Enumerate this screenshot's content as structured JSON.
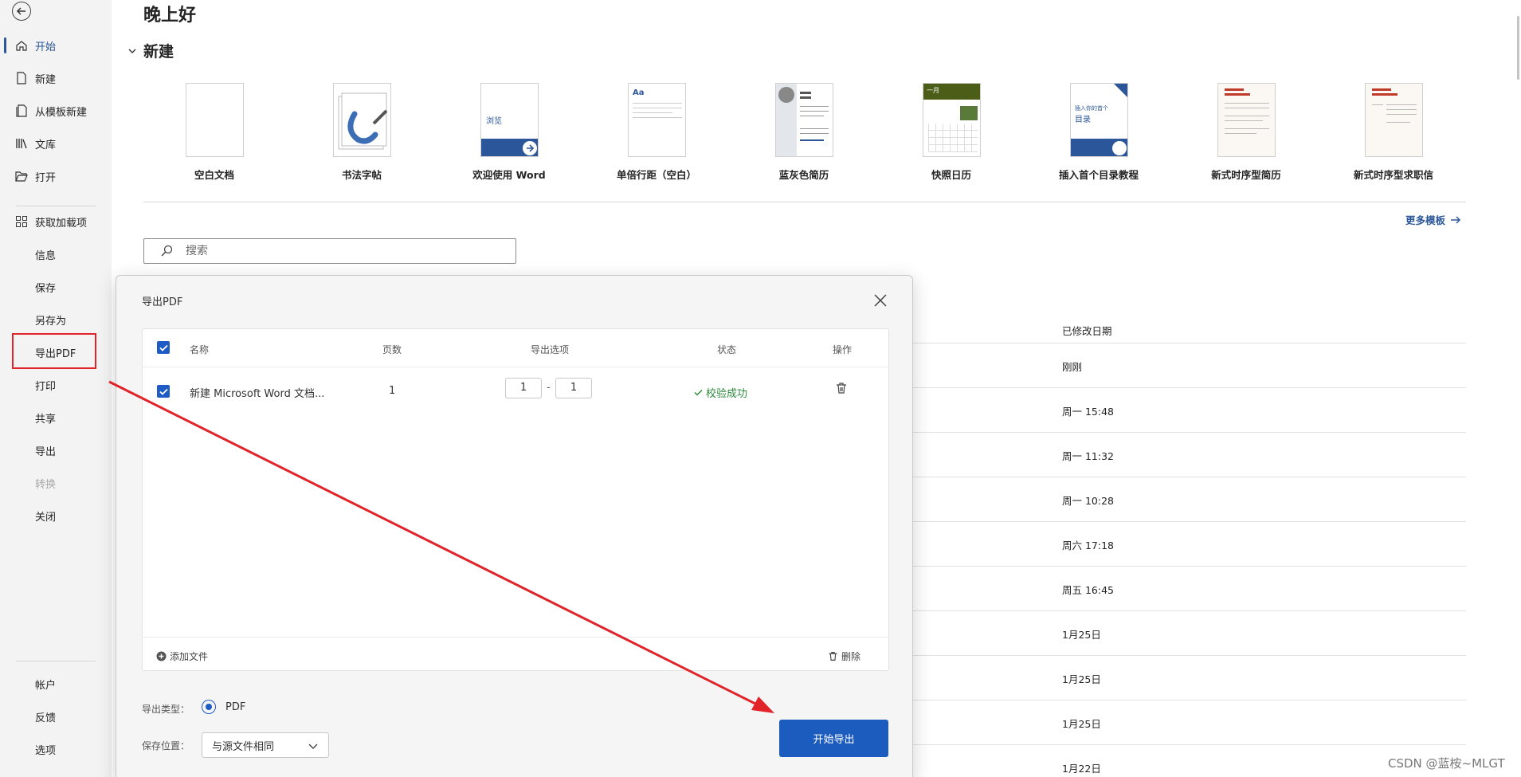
{
  "sidebar": {
    "items": [
      {
        "label": "开始"
      },
      {
        "label": "新建"
      },
      {
        "label": "从模板新建"
      },
      {
        "label": "文库"
      },
      {
        "label": "打开"
      },
      {
        "label": "获取加载项"
      },
      {
        "label": "信息"
      },
      {
        "label": "保存"
      },
      {
        "label": "另存为"
      },
      {
        "label": "导出PDF"
      },
      {
        "label": "打印"
      },
      {
        "label": "共享"
      },
      {
        "label": "导出"
      },
      {
        "label": "转换"
      },
      {
        "label": "关闭"
      },
      {
        "label": "帐户"
      },
      {
        "label": "反馈"
      },
      {
        "label": "选项"
      }
    ]
  },
  "main": {
    "greeting": "晚上好",
    "new_title": "新建",
    "templates": [
      {
        "label": "空白文档"
      },
      {
        "label": "书法字帖"
      },
      {
        "label": "欢迎使用 Word",
        "thumb_text": "浏览"
      },
      {
        "label": "单倍行距（空白）",
        "thumb_text": "Aa"
      },
      {
        "label": "蓝灰色简历"
      },
      {
        "label": "快照日历",
        "thumb_text": "一月"
      },
      {
        "label": "插入首个目录教程",
        "thumb_text": "插入你的首个",
        "thumb_text2": "目录"
      },
      {
        "label": "新式时序型简历"
      },
      {
        "label": "新式时序型求职信"
      }
    ],
    "more_templates": "更多模板",
    "search_placeholder": "搜索",
    "modified_header": "已修改日期",
    "dates": [
      "刚刚",
      "周一 15:48",
      "周一 11:32",
      "周一 10:28",
      "周六 17:18",
      "周五 16:45",
      "1月25日",
      "1月25日",
      "1月25日",
      "1月22日"
    ]
  },
  "dialog": {
    "title": "导出PDF",
    "headers": {
      "name": "名称",
      "pages": "页数",
      "options": "导出选项",
      "status": "状态",
      "action": "操作"
    },
    "rows": [
      {
        "name": "新建 Microsoft Word 文档...",
        "pages": "1",
        "from": "1",
        "dash": "-",
        "to": "1",
        "status": "校验成功"
      }
    ],
    "add_file": "添加文件",
    "delete": "删除",
    "export_type_label": "导出类型：",
    "export_type_value": "PDF",
    "save_location_label": "保存位置：",
    "save_location_value": "与源文件相同",
    "export_button": "开始导出"
  },
  "watermark": "CSDN @蓝桉~MLGT",
  "colors": {
    "accent": "#2b579a",
    "button": "#1c5cbf",
    "annotation": "#e0242a",
    "success": "#2e8a3e"
  }
}
